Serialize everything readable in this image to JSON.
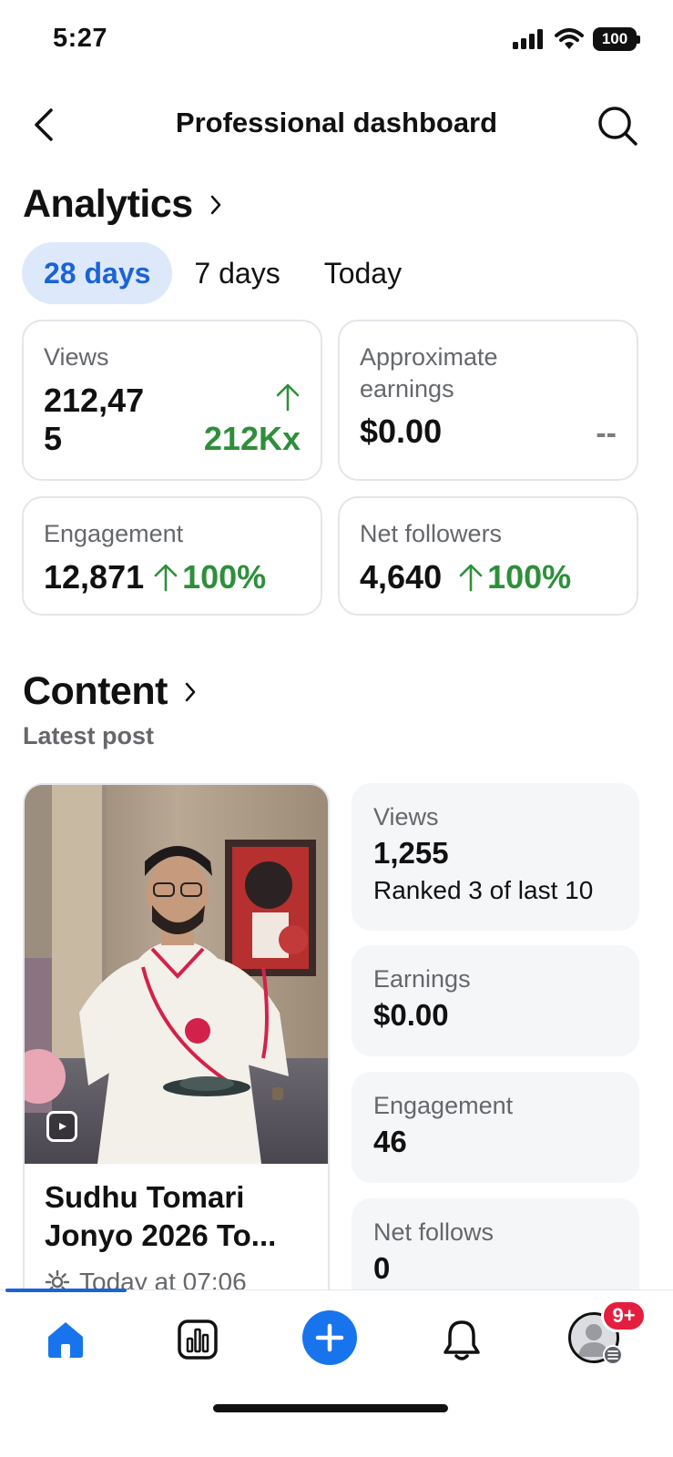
{
  "status_bar": {
    "time": "5:27",
    "battery": "100"
  },
  "header": {
    "title": "Professional dashboard"
  },
  "analytics": {
    "title": "Analytics",
    "tabs": [
      {
        "label": "28 days",
        "active": true
      },
      {
        "label": "7 days",
        "active": false
      },
      {
        "label": "Today",
        "active": false
      }
    ],
    "cards": {
      "views": {
        "label": "Views",
        "value_line1": "212,47",
        "value_line2": "5",
        "change": "212Kx"
      },
      "earnings": {
        "label_line1": "Approximate",
        "label_line2": "earnings",
        "value": "$0.00",
        "change": "--"
      },
      "engagement": {
        "label": "Engagement",
        "value": "12,871",
        "change": "100%"
      },
      "net_followers": {
        "label": "Net followers",
        "value": "4,640",
        "change": "100%"
      }
    }
  },
  "content": {
    "title": "Content",
    "subtitle": "Latest post",
    "post": {
      "title_line1": "Sudhu Tomari",
      "title_line2": "Jonyo 2026 To...",
      "meta": "Today at 07:06"
    },
    "stats": [
      {
        "label": "Views",
        "value": "1,255",
        "sub": "Ranked 3 of last 10"
      },
      {
        "label": "Earnings",
        "value": "$0.00"
      },
      {
        "label": "Engagement",
        "value": "46"
      },
      {
        "label": "Net follows",
        "value": "0"
      }
    ]
  },
  "bottom_nav": {
    "notification_badge": "9+"
  },
  "colors": {
    "accent": "#1a63d6",
    "positive": "#2e8f3a",
    "badge": "#e41e3f",
    "tab_active_bg": "#dde9fb"
  }
}
